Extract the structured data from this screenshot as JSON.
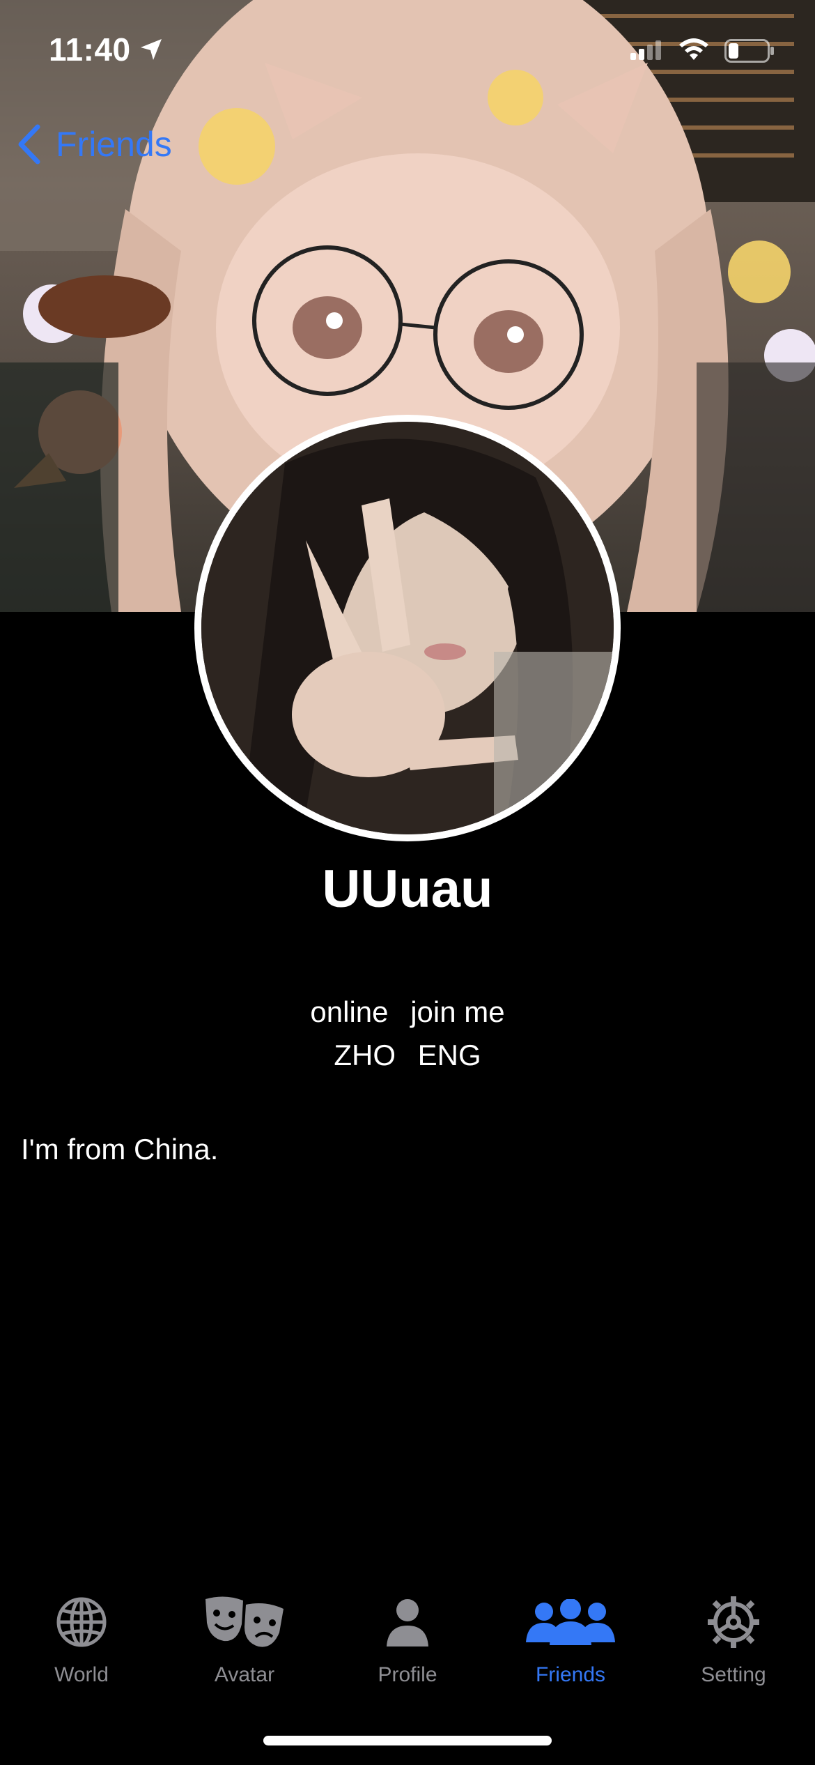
{
  "status_bar": {
    "time": "11:40"
  },
  "nav": {
    "back_label": "Friends"
  },
  "profile": {
    "username": "UUuau",
    "status": "online",
    "join_status": "join me",
    "languages": [
      "ZHO",
      "ENG"
    ],
    "bio": "I'm from China."
  },
  "tab_bar": {
    "tabs": [
      {
        "label": "World",
        "icon": "globe-icon",
        "active": false
      },
      {
        "label": "Avatar",
        "icon": "theater-masks-icon",
        "active": false
      },
      {
        "label": "Profile",
        "icon": "person-icon",
        "active": false
      },
      {
        "label": "Friends",
        "icon": "group-icon",
        "active": true
      },
      {
        "label": "Setting",
        "icon": "gear-icon",
        "active": false
      }
    ]
  },
  "colors": {
    "accent": "#3478f6",
    "inactive_tab": "#8e8e93",
    "background": "#000000"
  }
}
